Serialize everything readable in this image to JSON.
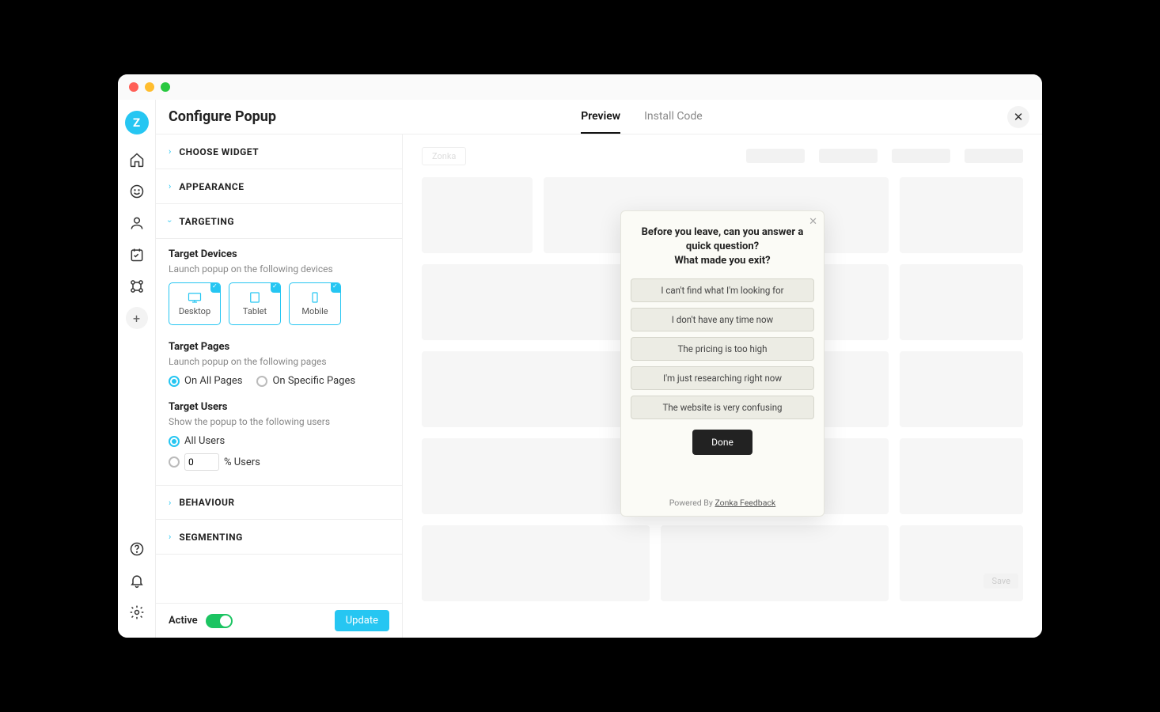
{
  "header": {
    "title": "Configure Popup",
    "tabs": {
      "preview": "Preview",
      "install": "Install Code"
    }
  },
  "nav": {
    "logo": "Z"
  },
  "sections": {
    "choose_widget": "CHOOSE WIDGET",
    "appearance": "APPEARANCE",
    "targeting": "TARGETING",
    "behaviour": "BEHAVIOUR",
    "segmenting": "SEGMENTING"
  },
  "targeting": {
    "devices_title": "Target Devices",
    "devices_sub": "Launch popup on the following devices",
    "devices": {
      "desktop": "Desktop",
      "tablet": "Tablet",
      "mobile": "Mobile"
    },
    "pages_title": "Target Pages",
    "pages_sub": "Launch popup on the following pages",
    "pages_opts": {
      "all": "On All Pages",
      "specific": "On Specific Pages"
    },
    "users_title": "Target Users",
    "users_sub": "Show the popup to the following users",
    "users_opts": {
      "all": "All Users",
      "pct_value": "0",
      "pct_suffix": "% Users"
    }
  },
  "footer": {
    "active": "Active",
    "update": "Update"
  },
  "preview_mock": {
    "logo": "Zonka",
    "save": "Save"
  },
  "popup": {
    "question": "Before you leave, can you answer a quick question?\nWhat made you exit?",
    "options": [
      "I can't find what I'm looking for",
      "I don't have any time now",
      "The pricing is too high",
      "I'm just researching right now",
      "The website is very confusing"
    ],
    "done": "Done",
    "powered_by_prefix": "Powered By ",
    "powered_by_link": "Zonka Feedback"
  }
}
